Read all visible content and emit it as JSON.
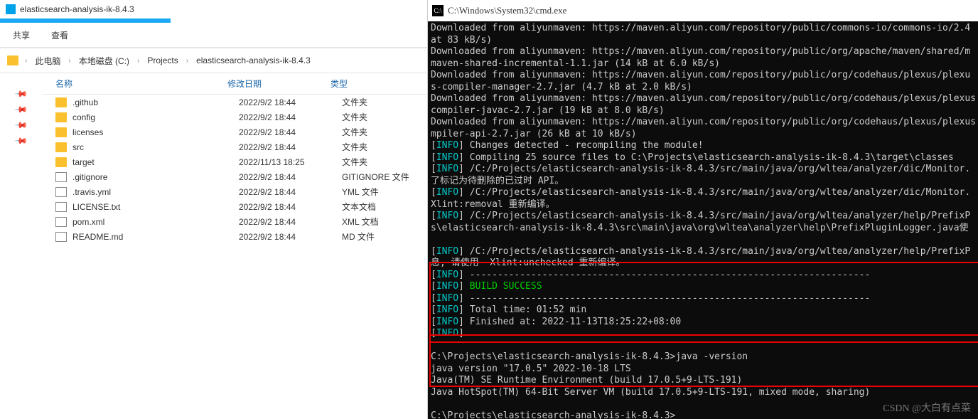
{
  "explorer": {
    "title": "elasticsearch-analysis-ik-8.4.3",
    "toolbar": {
      "share": "共享",
      "view": "查看"
    },
    "breadcrumb": [
      "此电脑",
      "本地磁盘 (C:)",
      "Projects",
      "elasticsearch-analysis-ik-8.4.3"
    ],
    "columns": {
      "name": "名称",
      "date": "修改日期",
      "type": "类型"
    },
    "files": [
      {
        "icon": "folder",
        "name": ".github",
        "date": "2022/9/2 18:44",
        "type": "文件夹"
      },
      {
        "icon": "folder",
        "name": "config",
        "date": "2022/9/2 18:44",
        "type": "文件夹"
      },
      {
        "icon": "folder",
        "name": "licenses",
        "date": "2022/9/2 18:44",
        "type": "文件夹"
      },
      {
        "icon": "folder",
        "name": "src",
        "date": "2022/9/2 18:44",
        "type": "文件夹"
      },
      {
        "icon": "folder",
        "name": "target",
        "date": "2022/11/13 18:25",
        "type": "文件夹"
      },
      {
        "icon": "file",
        "name": ".gitignore",
        "date": "2022/9/2 18:44",
        "type": "GITIGNORE 文件"
      },
      {
        "icon": "file",
        "name": ".travis.yml",
        "date": "2022/9/2 18:44",
        "type": "YML 文件"
      },
      {
        "icon": "file",
        "name": "LICENSE.txt",
        "date": "2022/9/2 18:44",
        "type": "文本文档"
      },
      {
        "icon": "file",
        "name": "pom.xml",
        "date": "2022/9/2 18:44",
        "type": "XML 文档"
      },
      {
        "icon": "file",
        "name": "README.md",
        "date": "2022/9/2 18:44",
        "type": "MD 文件"
      }
    ]
  },
  "cmd": {
    "title": "C:\\Windows\\System32\\cmd.exe",
    "lines": [
      {
        "pre": "",
        "t": "Downloaded from aliyunmaven: https://maven.aliyun.com/repository/public/commons-io/commons-io/2.4"
      },
      {
        "pre": "",
        "t": "at 83 kB/s)"
      },
      {
        "pre": "",
        "t": "Downloaded from aliyunmaven: https://maven.aliyun.com/repository/public/org/apache/maven/shared/m"
      },
      {
        "pre": "",
        "t": "maven-shared-incremental-1.1.jar (14 kB at 6.0 kB/s)"
      },
      {
        "pre": "",
        "t": "Downloaded from aliyunmaven: https://maven.aliyun.com/repository/public/org/codehaus/plexus/plexu"
      },
      {
        "pre": "",
        "t": "s-compiler-manager-2.7.jar (4.7 kB at 2.0 kB/s)"
      },
      {
        "pre": "",
        "t": "Downloaded from aliyunmaven: https://maven.aliyun.com/repository/public/org/codehaus/plexus/plexus"
      },
      {
        "pre": "",
        "t": "compiler-javac-2.7.jar (19 kB at 8.0 kB/s)"
      },
      {
        "pre": "",
        "t": "Downloaded from aliyunmaven: https://maven.aliyun.com/repository/public/org/codehaus/plexus/plexus"
      },
      {
        "pre": "",
        "t": "mpiler-api-2.7.jar (26 kB at 10 kB/s)"
      },
      {
        "pre": "info",
        "t": " Changes detected - recompiling the module!"
      },
      {
        "pre": "info",
        "t": " Compiling 25 source files to C:\\Projects\\elasticsearch-analysis-ik-8.4.3\\target\\classes"
      },
      {
        "pre": "info",
        "t": " /C:/Projects/elasticsearch-analysis-ik-8.4.3/src/main/java/org/wltea/analyzer/dic/Monitor."
      },
      {
        "pre": "",
        "t": "了标记为待删除的已过时 API。"
      },
      {
        "pre": "info",
        "t": " /C:/Projects/elasticsearch-analysis-ik-8.4.3/src/main/java/org/wltea/analyzer/dic/Monitor."
      },
      {
        "pre": "",
        "t": "Xlint:removal 重新编译。"
      },
      {
        "pre": "info",
        "t": " /C:/Projects/elasticsearch-analysis-ik-8.4.3/src/main/java/org/wltea/analyzer/help/PrefixP"
      },
      {
        "pre": "",
        "t": "s\\elasticsearch-analysis-ik-8.4.3\\src\\main\\java\\org\\wltea\\analyzer\\help\\PrefixPluginLogger.java使"
      },
      {
        "pre": "",
        "t": ""
      },
      {
        "pre": "info",
        "t": " /C:/Projects/elasticsearch-analysis-ik-8.4.3/src/main/java/org/wltea/analyzer/help/PrefixP"
      },
      {
        "pre": "",
        "t": "息, 请使用 -Xlint:unchecked 重新编译。"
      },
      {
        "pre": "info",
        "t": " ------------------------------------------------------------------------"
      },
      {
        "pre": "info",
        "t": "",
        "succ": " BUILD SUCCESS"
      },
      {
        "pre": "info",
        "t": " ------------------------------------------------------------------------"
      },
      {
        "pre": "info",
        "t": " Total time:  01:52 min"
      },
      {
        "pre": "info",
        "t": " Finished at: 2022-11-13T18:25:22+08:00"
      },
      {
        "pre": "info",
        "t": ""
      },
      {
        "pre": "",
        "t": ""
      },
      {
        "pre": "",
        "t": "C:\\Projects\\elasticsearch-analysis-ik-8.4.3>java -version"
      },
      {
        "pre": "",
        "t": "java version \"17.0.5\" 2022-10-18 LTS"
      },
      {
        "pre": "",
        "t": "Java(TM) SE Runtime Environment (build 17.0.5+9-LTS-191)"
      },
      {
        "pre": "",
        "t": "Java HotSpot(TM) 64-Bit Server VM (build 17.0.5+9-LTS-191, mixed mode, sharing)"
      },
      {
        "pre": "",
        "t": ""
      },
      {
        "pre": "",
        "t": "C:\\Projects\\elasticsearch-analysis-ik-8.4.3>"
      }
    ],
    "watermark": "CSDN @大白有点菜"
  }
}
